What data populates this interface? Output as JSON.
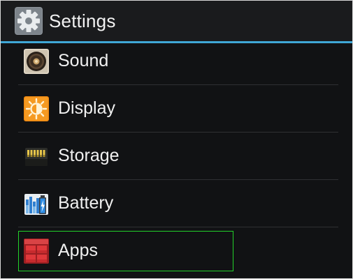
{
  "actionbar": {
    "title": "Settings",
    "app_icon": "gear-icon",
    "divider_color": "#3fa7d6"
  },
  "settings_list": [
    {
      "label": "Sound",
      "icon": "sound-speaker-icon"
    },
    {
      "label": "Display",
      "icon": "display-brightness-icon"
    },
    {
      "label": "Storage",
      "icon": "storage-sdcard-icon"
    },
    {
      "label": "Battery",
      "icon": "battery-icon"
    },
    {
      "label": "Apps",
      "icon": "apps-grid-icon"
    }
  ],
  "highlight": {
    "item": "Apps",
    "color": "#22d22a"
  }
}
